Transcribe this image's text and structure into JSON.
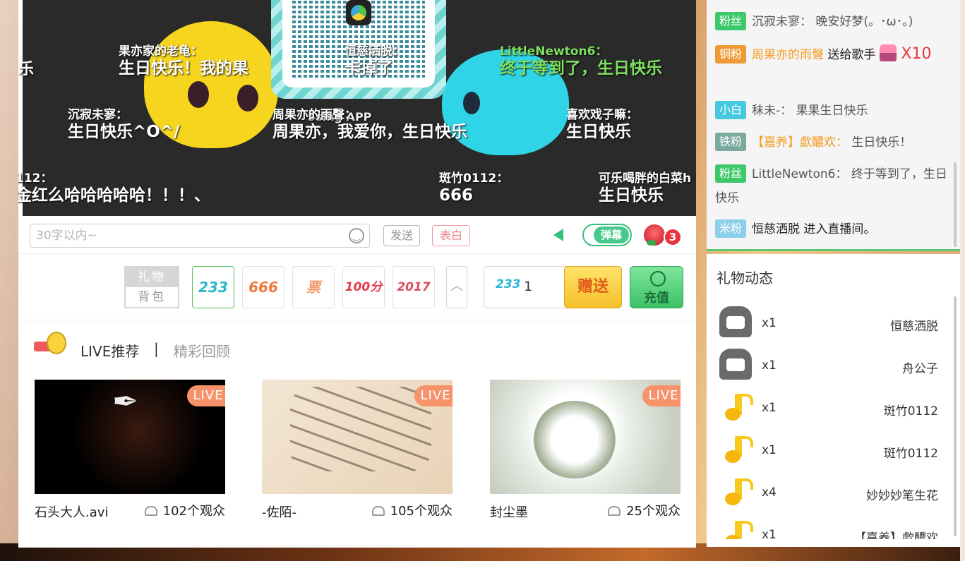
{
  "danmaku": [
    {
      "name": "果亦家的老龟：",
      "text": "生日快乐！我的果",
      "style": "white"
    },
    {
      "name": "恒慈洒脱：",
      "text": "卡掉了",
      "style": "white"
    },
    {
      "name": "LittleNewton6：",
      "text": "终于等到了，生日快乐",
      "style": "green"
    },
    {
      "name": "沉寂未寥：",
      "text": "生日快乐^O^/",
      "style": "white"
    },
    {
      "name": "周果亦的雨聲：",
      "text": "周果亦，我爱你，生日快乐",
      "style": "white"
    },
    {
      "name": "喜欢戏子嘛：",
      "text": "生日快乐",
      "style": "white"
    },
    {
      "name": "112：",
      "text": "金红么哈哈哈哈哈！！！、",
      "style": "white"
    },
    {
      "name": "斑竹0112：",
      "text": "666",
      "style": "white"
    },
    {
      "name": "可乐喝胖的白菜h",
      "text": "生日快乐",
      "style": "white"
    }
  ],
  "video": {
    "watermark": "5sing APP",
    "edge_text": "乐"
  },
  "chat_input": {
    "placeholder": "30字以内~",
    "value": ""
  },
  "buttons": {
    "send": "发送",
    "confess": "表白",
    "danmaku_toggle": "弹幕",
    "give": "赠送",
    "recharge": "充值"
  },
  "rose_count": "3",
  "gift_tabs": {
    "gifts": "礼物",
    "backpack": "背包"
  },
  "gifts": [
    {
      "label": "233",
      "color": "#2ab8c9"
    },
    {
      "label": "666",
      "color": "#f07a3a"
    },
    {
      "label": "票",
      "color": "#f29a6a"
    },
    {
      "label": "100分",
      "color": "#e3394a"
    },
    {
      "label": "2017",
      "color": "#d94f5f"
    }
  ],
  "quantity": {
    "icon_label": "233",
    "value": "1"
  },
  "recommend": {
    "tab_live": "LIVE推荐",
    "separator": "|",
    "tab_replay": "精彩回顾"
  },
  "cards": [
    {
      "title": "石头大人.avi",
      "viewers": "102个观众",
      "badge": "LIVE"
    },
    {
      "title": "-佐陌-",
      "viewers": "105个观众",
      "badge": "LIVE"
    },
    {
      "title": "封尘墨",
      "viewers": "25个观众",
      "badge": "LIVE"
    }
  ],
  "chat": [
    {
      "badge": "粉丝",
      "badge_type": "fan",
      "user": "沉寂未寥：",
      "text": "晚安好梦(。･ω･。)"
    },
    {
      "badge": "铜粉",
      "badge_type": "cu",
      "user": "周果亦的雨聲",
      "text": "送给歌手",
      "gift_count": "X10"
    },
    {
      "badge": "小白",
      "badge_type": "bai",
      "user": "秣未-：",
      "text": "果果生日快乐"
    },
    {
      "badge": "铁粉",
      "badge_type": "tie",
      "user": "【嘉养】歔醲欢：",
      "text": "生日快乐！"
    },
    {
      "badge": "粉丝",
      "badge_type": "fan",
      "user": "LittleNewton6：",
      "text": "终于等到了，生日快乐"
    },
    {
      "badge": "米粉",
      "badge_type": "mi",
      "user": "恒慈洒脱",
      "text": "进入直播间。"
    }
  ],
  "gift_feed": {
    "title": "礼物动态",
    "items": [
      {
        "icon": "sofa-icon",
        "count": "x1",
        "user": "恒慈洒脱"
      },
      {
        "icon": "sofa-icon",
        "count": "x1",
        "user": "舟公子"
      },
      {
        "icon": "music-note-icon",
        "count": "x1",
        "user": "斑竹0112"
      },
      {
        "icon": "music-note-icon",
        "count": "x1",
        "user": "斑竹0112"
      },
      {
        "icon": "music-note-icon",
        "count": "x4",
        "user": "妙妙妙笔生花"
      },
      {
        "icon": "music-note-icon",
        "count": "x1",
        "user": "【嘉养】歔醲欢"
      }
    ]
  },
  "colors": {
    "accent_green": "#35c17c",
    "live_badge": "#f7936a",
    "highlight_orange": "#f39b1f"
  }
}
